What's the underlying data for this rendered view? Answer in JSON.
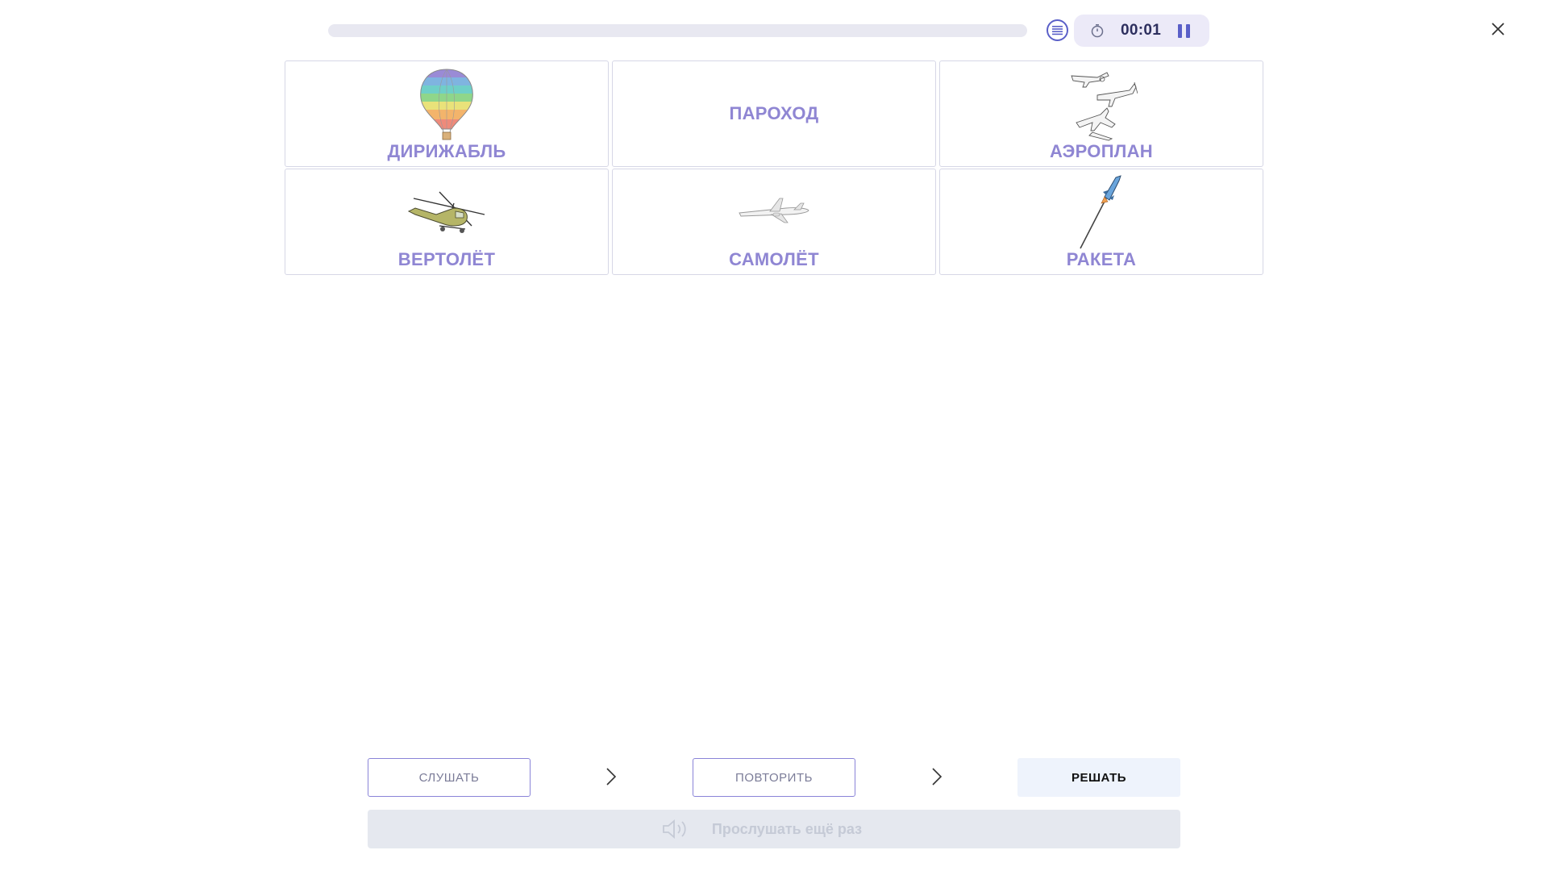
{
  "header": {
    "progress": 0,
    "timer": "00:01"
  },
  "cards": [
    {
      "label": "ДИРИЖАБЛЬ",
      "icon": "hot-air-balloon-icon"
    },
    {
      "label": "ПАРОХОД",
      "icon": ""
    },
    {
      "label": "АЭРОПЛАН",
      "icon": "airplanes-icon"
    },
    {
      "label": "ВЕРТОЛЁТ",
      "icon": "helicopter-icon"
    },
    {
      "label": "САМОЛЁТ",
      "icon": "jet-plane-icon"
    },
    {
      "label": "РАКЕТА",
      "icon": "rocket-icon"
    }
  ],
  "steps": {
    "listen": "СЛУШАТЬ",
    "repeat": "ПОВТОРИТЬ",
    "solve": "РЕШАТЬ"
  },
  "listen_again": "Прослушать ещё раз",
  "colors": {
    "accent": "#5a5fc8",
    "label": "#8f86d3",
    "border": "#d6d7e6"
  }
}
